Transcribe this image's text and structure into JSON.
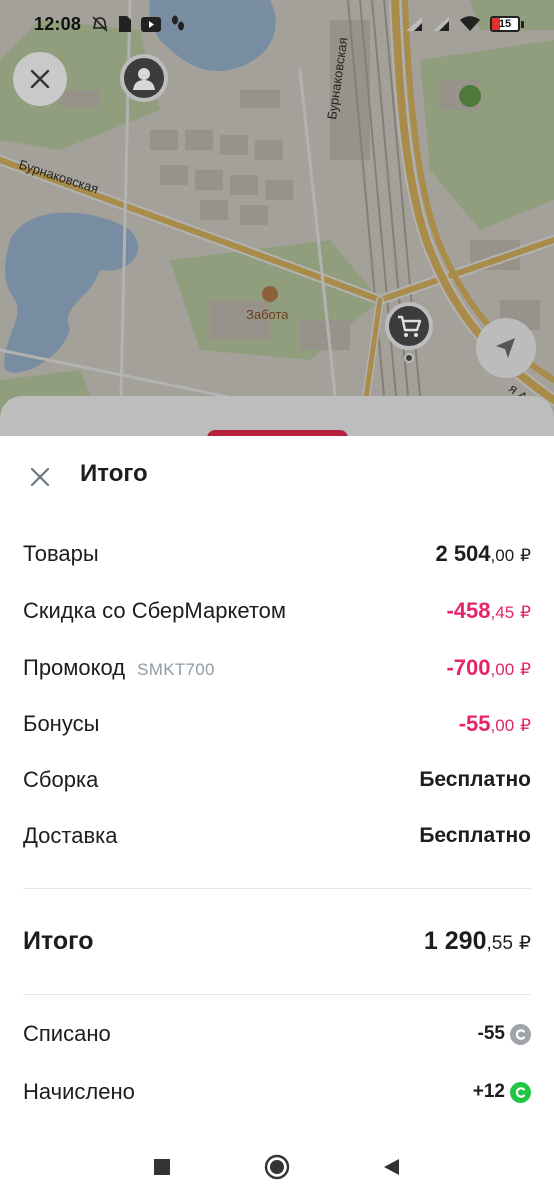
{
  "status_bar": {
    "time": "12:08",
    "battery_level": "15",
    "battery_color": "#e0322e",
    "icons_left": [
      "alarm-off-icon",
      "sim-icon",
      "youtube-icon",
      "steps-icon"
    ],
    "icons_right": [
      "signal-icon",
      "signal-icon",
      "wifi-icon",
      "battery-icon"
    ]
  },
  "map": {
    "street_1": "Бурнаковская",
    "street_2": "Бурнаковская",
    "street_3": "я Ак",
    "poi_label": "Забота",
    "icons": [
      "close-icon",
      "courier-pin-icon",
      "cart-pin-icon",
      "navigate-icon",
      "tree-icon"
    ]
  },
  "sheet": {
    "title": "Итого",
    "rows": [
      {
        "label": "Товары",
        "int": "2 504",
        "dec": ",00",
        "cur": "₽",
        "negative": false
      },
      {
        "label": "Скидка со СберМаркетом",
        "int": "-458",
        "dec": ",45",
        "cur": "₽",
        "negative": true
      },
      {
        "label": "Промокод",
        "code": "SMKT700",
        "int": "-700",
        "dec": ",00",
        "cur": "₽",
        "negative": true
      },
      {
        "label": "Бонусы",
        "int": "-55",
        "dec": ",00",
        "cur": "₽",
        "negative": true
      },
      {
        "label": "Сборка",
        "value": "Бесплатно"
      },
      {
        "label": "Доставка",
        "value": "Бесплатно"
      }
    ],
    "total": {
      "label": "Итого",
      "int": "1 290",
      "dec": ",55",
      "cur": "₽"
    },
    "bonus_rows": [
      {
        "label": "Списано",
        "value": "-55",
        "badge_color": "#a0a4a8"
      },
      {
        "label": "Начислено",
        "value": "+12",
        "badge_color": "#21c445"
      }
    ]
  },
  "colors": {
    "negative": "#e6246c",
    "accent_behind": "#b3213e"
  },
  "nav_bar": {
    "icons": [
      "recent-apps-icon",
      "home-icon",
      "back-icon"
    ]
  }
}
